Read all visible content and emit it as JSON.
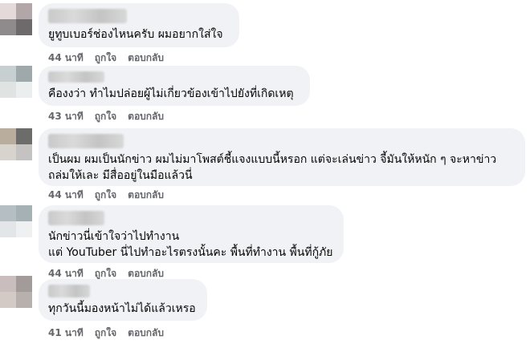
{
  "comments": [
    {
      "text_lines": [
        "ยูทูบเบอร์ช่องไหนครับ ผมอยากใส่ใจ"
      ],
      "time": "44 นาที",
      "like": "ถูกใจ",
      "reply": "ตอบกลับ"
    },
    {
      "text_lines": [
        "คืองงว่า ทำไมปล่อยผู้ไม่เกี่ยวข้องเข้าไปยังที่เกิดเหตุ"
      ],
      "time": "43 นาที",
      "like": "ถูกใจ",
      "reply": "ตอบกลับ"
    },
    {
      "text_lines": [
        "เป็นผม ผมเป็นนักข่าว ผมไม่มาโพสต์ชี้แจงแบบนี้หรอก แต่จะเล่นข่าว จี้มันให้หนัก ๆ จะหาข่าว",
        "ถล่มให้เละ มีสื่ออยู่ในมือแล้วนี่"
      ],
      "time": "44 นาที",
      "like": "ถูกใจ",
      "reply": "ตอบกลับ"
    },
    {
      "text_lines": [
        "นักข่าวนี่เข้าใจว่าไปทำงาน",
        "แต่ YouTuber นี่ไปทำอะไรตรงนั้นคะ พื้นที่ทำงาน พื้นที่กู้ภัย"
      ],
      "time": "44 นาที",
      "like": "ถูกใจ",
      "reply": "ตอบกลับ"
    },
    {
      "text_lines": [
        "ทุกวันนี้มองหน้าไม่ได้แล้วเหรอ"
      ],
      "time": "41 นาที",
      "like": "ถูกใจ",
      "reply": "ตอบกลับ"
    }
  ]
}
